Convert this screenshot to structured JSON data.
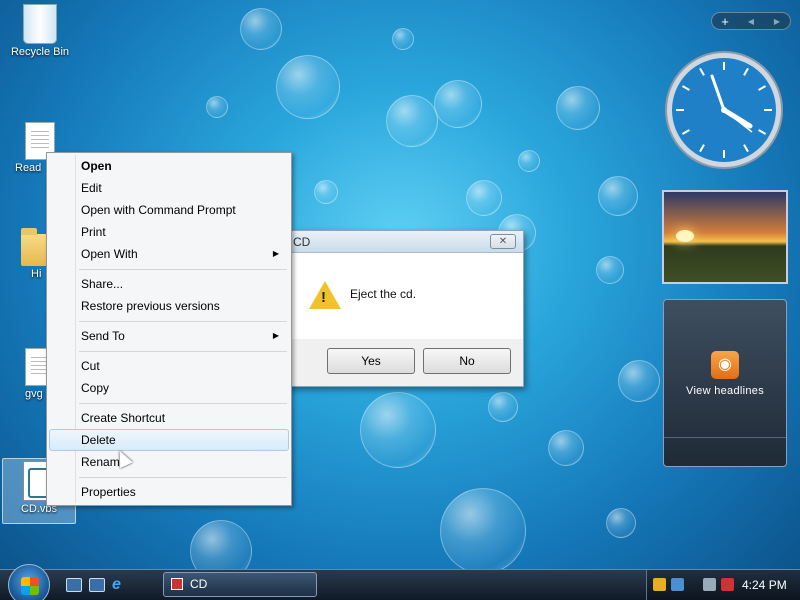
{
  "desktop": {
    "icons": [
      {
        "label": "Recycle Bin"
      },
      {
        "label": "Read"
      },
      {
        "label": "Hi"
      },
      {
        "label": "gvg"
      },
      {
        "label": "CD.vbs"
      }
    ]
  },
  "gadgets": {
    "toolbar": {
      "add": "+",
      "prev": "◀",
      "next": "▶"
    },
    "clock": {
      "time": "4:24"
    },
    "feed": {
      "label": "View headlines"
    }
  },
  "dialog": {
    "title": "CD",
    "close": "✕",
    "message": "Eject the cd.",
    "yes": "Yes",
    "no": "No"
  },
  "context_menu": {
    "items": [
      {
        "label": "Open",
        "bold": true
      },
      {
        "label": "Edit"
      },
      {
        "label": "Open with Command Prompt"
      },
      {
        "label": "Print"
      },
      {
        "label": "Open With",
        "submenu": true
      },
      {
        "label": "Share..."
      },
      {
        "label": "Restore previous versions"
      },
      {
        "label": "Send To",
        "submenu": true
      },
      {
        "label": "Cut"
      },
      {
        "label": "Copy"
      },
      {
        "label": "Create Shortcut"
      },
      {
        "label": "Delete",
        "highlighted": true
      },
      {
        "label": "Rename"
      },
      {
        "label": "Properties"
      }
    ],
    "submenu_arrow": "▶"
  },
  "taskbar": {
    "task_label": "CD",
    "clock": "4:24 PM"
  }
}
